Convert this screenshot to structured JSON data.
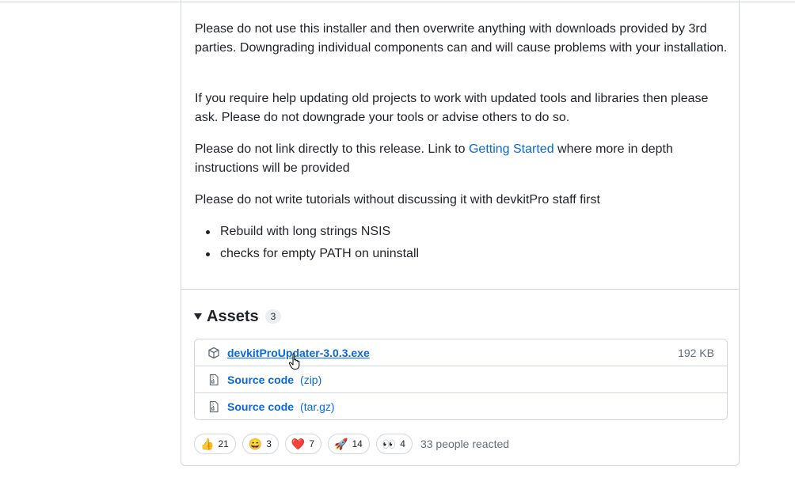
{
  "release": {
    "paragraphs": [
      {
        "text": "Please do not use this installer and then overwrite anything with downloads provided by 3rd parties. Downgrading individual components can and will cause problems with your installation."
      },
      {
        "text": "If you require help updating old projects to work with updated tools and libraries then please ask. Please do not downgrade your tools or advise others to do so."
      },
      {
        "before": "Please do not link directly to this release. Link to ",
        "link": "Getting Started",
        "after": " where more in depth instructions will be provided"
      },
      {
        "text": "Please do not write tutorials without discussing it with devkitPro staff first"
      }
    ],
    "bullets": [
      "Rebuild with long strings NSIS",
      "checks for empty PATH on uninstall"
    ]
  },
  "assets": {
    "title": "Assets",
    "count": "3",
    "items": [
      {
        "icon": "package-icon",
        "name": "devkitProUpdater-3.0.3.exe",
        "size": "192 KB"
      },
      {
        "icon": "file-zip-icon",
        "name": "Source code",
        "format": "(zip)"
      },
      {
        "icon": "file-zip-icon",
        "name": "Source code",
        "format": "(tar.gz)"
      }
    ]
  },
  "reactions": {
    "items": [
      {
        "icon": "thumbs-up",
        "emoji": "👍",
        "count": "21"
      },
      {
        "icon": "laugh",
        "emoji": "😄",
        "count": "3"
      },
      {
        "icon": "heart",
        "emoji": "❤️",
        "count": "7"
      },
      {
        "icon": "rocket",
        "emoji": "🚀",
        "count": "14"
      },
      {
        "icon": "eyes",
        "emoji": "👀",
        "count": "4"
      }
    ],
    "summary": "33 people reacted"
  }
}
